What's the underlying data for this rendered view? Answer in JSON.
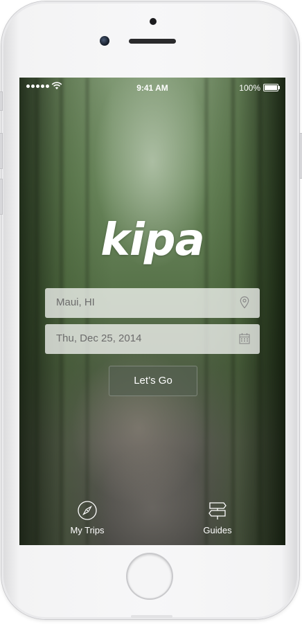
{
  "status_bar": {
    "time": "9:41 AM",
    "battery": "100%"
  },
  "app": {
    "logo": "kipa"
  },
  "form": {
    "location_value": "Maui, HI",
    "date_value": "Thu, Dec 25, 2014",
    "submit_label": "Let’s Go"
  },
  "tab_bar": {
    "items": [
      {
        "label": "My Trips",
        "icon": "compass-icon"
      },
      {
        "label": "Guides",
        "icon": "signpost-icon"
      }
    ]
  },
  "colors": {
    "field_bg": "#ffffffb8",
    "button_bg": "#555f50b8",
    "foliage": "#58734a"
  }
}
